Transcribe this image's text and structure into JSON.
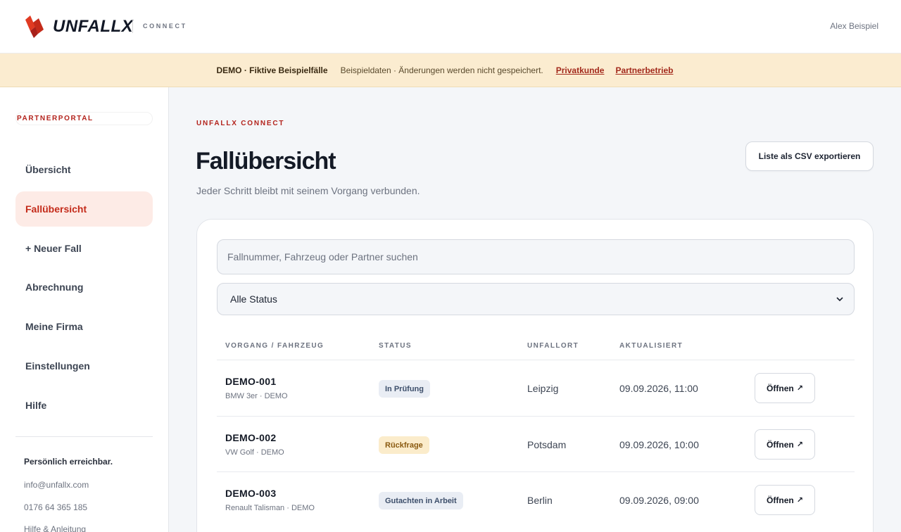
{
  "header": {
    "logo_text": "UNFALLX",
    "logo_sub": "CONNECT",
    "user_name": "Alex Beispiel"
  },
  "banner": {
    "strong": "DEMO · Fiktive Beispielfälle",
    "text": "Beispieldaten · Änderungen werden nicht gespeichert.",
    "link_private": "Privatkunde",
    "link_partner": "Partnerbetrieb"
  },
  "sidebar": {
    "tag": "PARTNERPORTAL",
    "items": [
      {
        "label": "Übersicht",
        "active": false
      },
      {
        "label": "Fallübersicht",
        "active": true
      },
      {
        "label": "+ Neuer Fall",
        "active": false
      },
      {
        "label": "Abrechnung",
        "active": false
      },
      {
        "label": "Meine Firma",
        "active": false
      },
      {
        "label": "Einstellungen",
        "active": false
      },
      {
        "label": "Hilfe",
        "active": false
      }
    ],
    "contact": {
      "title": "Persönlich erreichbar.",
      "email": "info@unfallx.com",
      "phone": "0176 64 365 185",
      "help": "Hilfe & Anleitung"
    }
  },
  "main": {
    "eyebrow": "UNFALLX CONNECT",
    "title": "Fallübersicht",
    "subtitle": "Jeder Schritt bleibt mit seinem Vorgang verbunden.",
    "export_label": "Liste als CSV exportieren",
    "search_placeholder": "Fallnummer, Fahrzeug oder Partner suchen",
    "status_selected": "Alle Status",
    "columns": [
      "VORGANG / FAHRZEUG",
      "STATUS",
      "UNFALLORT",
      "AKTUALISIERT"
    ],
    "open_label": "Öffnen",
    "rows": [
      {
        "id": "DEMO-001",
        "car": "BMW 3er · DEMO",
        "status": "In Prüfung",
        "status_bg": "#e9edf4",
        "status_fg": "#3d4f6b",
        "location": "Leipzig",
        "updated": "09.09.2026, 11:00"
      },
      {
        "id": "DEMO-002",
        "car": "VW Golf · DEMO",
        "status": "Rückfrage",
        "status_bg": "#fbeccb",
        "status_fg": "#8a5a10",
        "location": "Potsdam",
        "updated": "09.09.2026, 10:00"
      },
      {
        "id": "DEMO-003",
        "car": "Renault Talisman · DEMO",
        "status": "Gutachten in Arbeit",
        "status_bg": "#e9edf4",
        "status_fg": "#3d4f6b",
        "location": "Berlin",
        "updated": "09.09.2026, 09:00"
      }
    ]
  },
  "colors": {
    "accent": "#c42b1a",
    "banner_bg": "#fbecd0"
  }
}
